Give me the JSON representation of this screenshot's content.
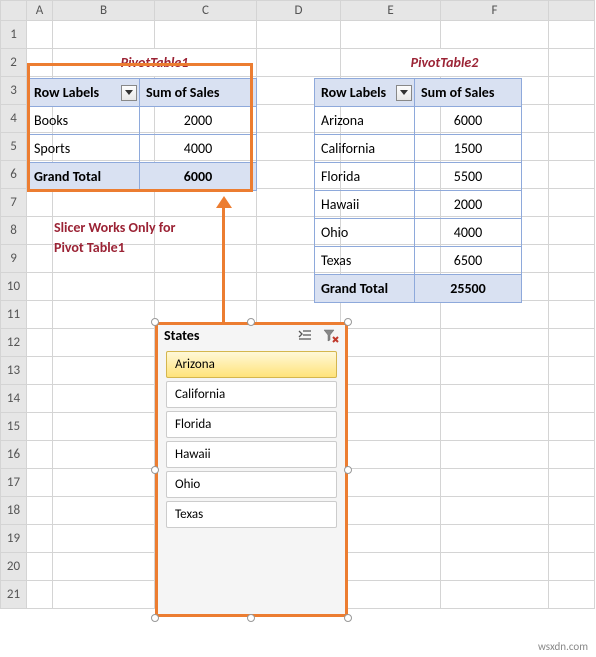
{
  "columns": [
    "A",
    "B",
    "C",
    "D",
    "E",
    "F"
  ],
  "rows": [
    "1",
    "2",
    "3",
    "4",
    "5",
    "6",
    "7",
    "8",
    "9",
    "10",
    "11",
    "12",
    "13",
    "14",
    "15",
    "16",
    "17",
    "18",
    "19",
    "20",
    "21"
  ],
  "pivot1": {
    "title": "PivotTable1",
    "rowLabels": "Row Labels",
    "sumHeader": "Sum of Sales",
    "data": [
      {
        "label": "Books",
        "value": "2000"
      },
      {
        "label": "Sports",
        "value": "4000"
      }
    ],
    "grandLabel": "Grand Total",
    "grandValue": "6000"
  },
  "pivot2": {
    "title": "PivotTable2",
    "rowLabels": "Row Labels",
    "sumHeader": "Sum of Sales",
    "data": [
      {
        "label": "Arizona",
        "value": "6000"
      },
      {
        "label": "California",
        "value": "1500"
      },
      {
        "label": "Florida",
        "value": "5500"
      },
      {
        "label": "Hawaii",
        "value": "2000"
      },
      {
        "label": "Ohio",
        "value": "4000"
      },
      {
        "label": "Texas",
        "value": "6500"
      }
    ],
    "grandLabel": "Grand Total",
    "grandValue": "25500"
  },
  "note": {
    "line1": "Slicer Works Only for",
    "line2": "Pivot Table1"
  },
  "slicer": {
    "title": "States",
    "items": [
      "Arizona",
      "California",
      "Florida",
      "Hawaii",
      "Ohio",
      "Texas"
    ]
  },
  "watermark": "wsxdn.com"
}
